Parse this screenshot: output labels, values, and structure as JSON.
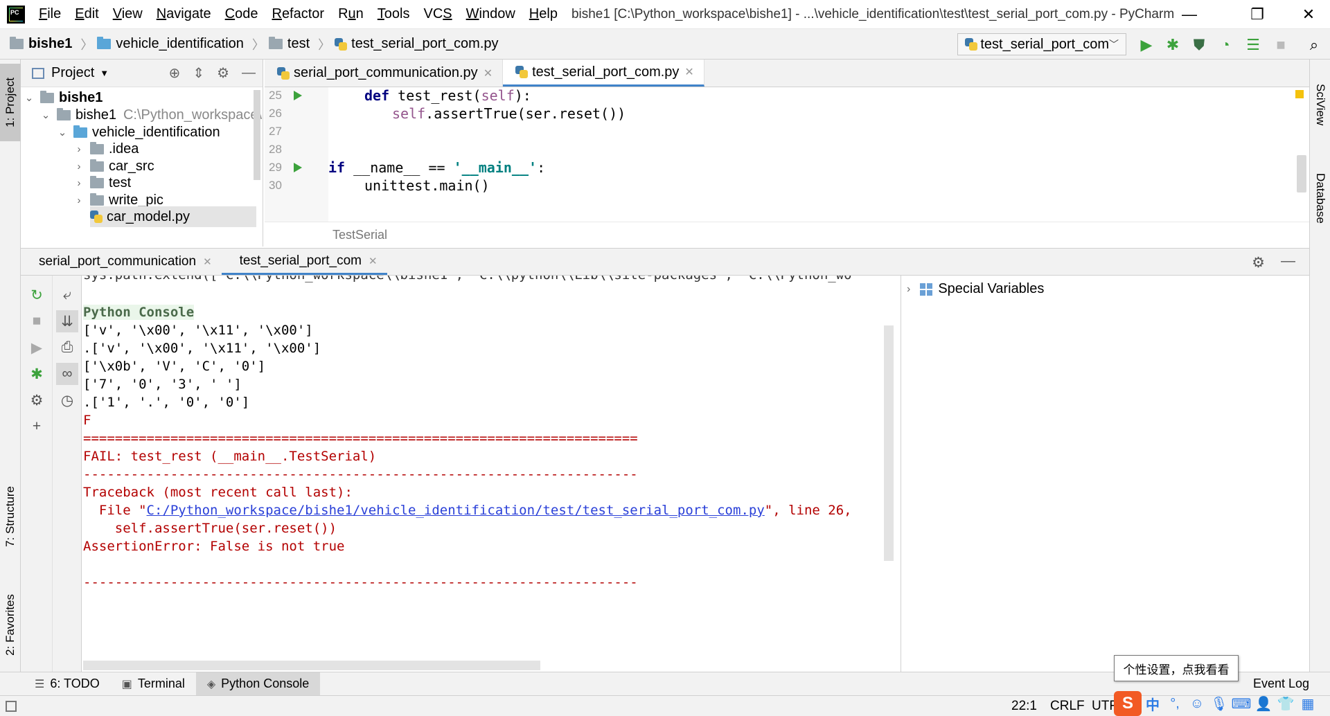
{
  "menubar": {
    "items": [
      {
        "label": "File",
        "u": "F"
      },
      {
        "label": "Edit",
        "u": "E"
      },
      {
        "label": "View",
        "u": "V"
      },
      {
        "label": "Navigate",
        "u": "N"
      },
      {
        "label": "Code",
        "u": "C"
      },
      {
        "label": "Refactor",
        "u": "R"
      },
      {
        "label": "Run",
        "u": "u"
      },
      {
        "label": "Tools",
        "u": "T"
      },
      {
        "label": "VCS",
        "u": "S"
      },
      {
        "label": "Window",
        "u": "W"
      },
      {
        "label": "Help",
        "u": "H"
      }
    ],
    "window_title": "bishe1 [C:\\Python_workspace\\bishe1] - ...\\vehicle_identification\\test\\test_serial_port_com.py - PyCharm",
    "minimize": "—",
    "restore": "❐",
    "close": "✕"
  },
  "navbar": {
    "crumbs": [
      "bishe1",
      "vehicle_identification",
      "test",
      "test_serial_port_com.py"
    ],
    "run_config": "test_serial_port_com"
  },
  "left_strip": {
    "project": "1: Project",
    "structure": "7: Structure",
    "favorites": "2: Favorites"
  },
  "right_strip": {
    "sciview": "SciView",
    "database": "Database"
  },
  "project": {
    "header": "Project",
    "tree": [
      {
        "label": "bishe1",
        "bold": true
      },
      {
        "label": "bishe1",
        "extra": "C:\\Python_workspace\\"
      },
      {
        "label": "vehicle_identification"
      },
      {
        "label": ".idea"
      },
      {
        "label": "car_src"
      },
      {
        "label": "test"
      },
      {
        "label": "write_pic"
      },
      {
        "label": "car_model.py"
      }
    ]
  },
  "editor": {
    "tabs": [
      {
        "label": "serial_port_communication.py"
      },
      {
        "label": "test_serial_port_com.py"
      }
    ],
    "line_numbers": [
      "25",
      "26",
      "27",
      "28",
      "29",
      "30"
    ],
    "code": {
      "l25_kw": "def",
      "l25_rest": " test_rest(",
      "l25_self": "self",
      "l25_end": "):",
      "l26_self": "self",
      "l26_rest": ".assertTrue(ser.reset())",
      "l29_kw": "if",
      "l29_mid": " __name__ == ",
      "l29_str": "'__main__'",
      "l29_end": ":",
      "l30": "unittest.main()"
    },
    "breadcrumb": "TestSerial"
  },
  "console": {
    "tabs": [
      {
        "label": "serial_port_communication"
      },
      {
        "label": "test_serial_port_com"
      }
    ],
    "lines": {
      "l0": "sys.path.extend(['C:\\\\Python_workspace\\\\bishe1', 'C:\\\\python\\\\Lib\\\\site-packages', 'C:\\\\Python_wo",
      "l1": "Python Console",
      "l2": "['v', '\\x00', '\\x11', '\\x00']",
      "l3": ".['v', '\\x00', '\\x11', '\\x00']",
      "l4": "['\\x0b', 'V', 'C', '0']",
      "l5": "['7', '0', '3', ' ']",
      "l6": ".['1', '.', '0', '0']",
      "l7": "F",
      "l8": "======================================================================",
      "l9": "FAIL: test_rest (__main__.TestSerial)",
      "l10": "----------------------------------------------------------------------",
      "l11": "Traceback (most recent call last):",
      "l12_pre": "  File \"",
      "l12_link": "C:/Python_workspace/bishe1/vehicle_identification/test/test_serial_port_com.py",
      "l12_post": "\", line 26,",
      "l13": "    self.assertTrue(ser.reset())",
      "l14": "AssertionError: False is not true",
      "l15": "----------------------------------------------------------------------"
    },
    "special_variables": "Special Variables"
  },
  "bottom_tools": {
    "todo": "6: TODO",
    "terminal": "Terminal",
    "python_console": "Python Console",
    "event_log": "Event Log"
  },
  "statusbar": {
    "position": "22:1",
    "line_sep": "CRLF",
    "encoding": "UTF-8"
  },
  "ime": {
    "tooltip": "个性设置，点我看看",
    "lang": "中"
  },
  "colors": {
    "accent": "#4083c9",
    "error": "#b30000",
    "run_green": "#3ca23c",
    "link": "#2a40d8"
  }
}
